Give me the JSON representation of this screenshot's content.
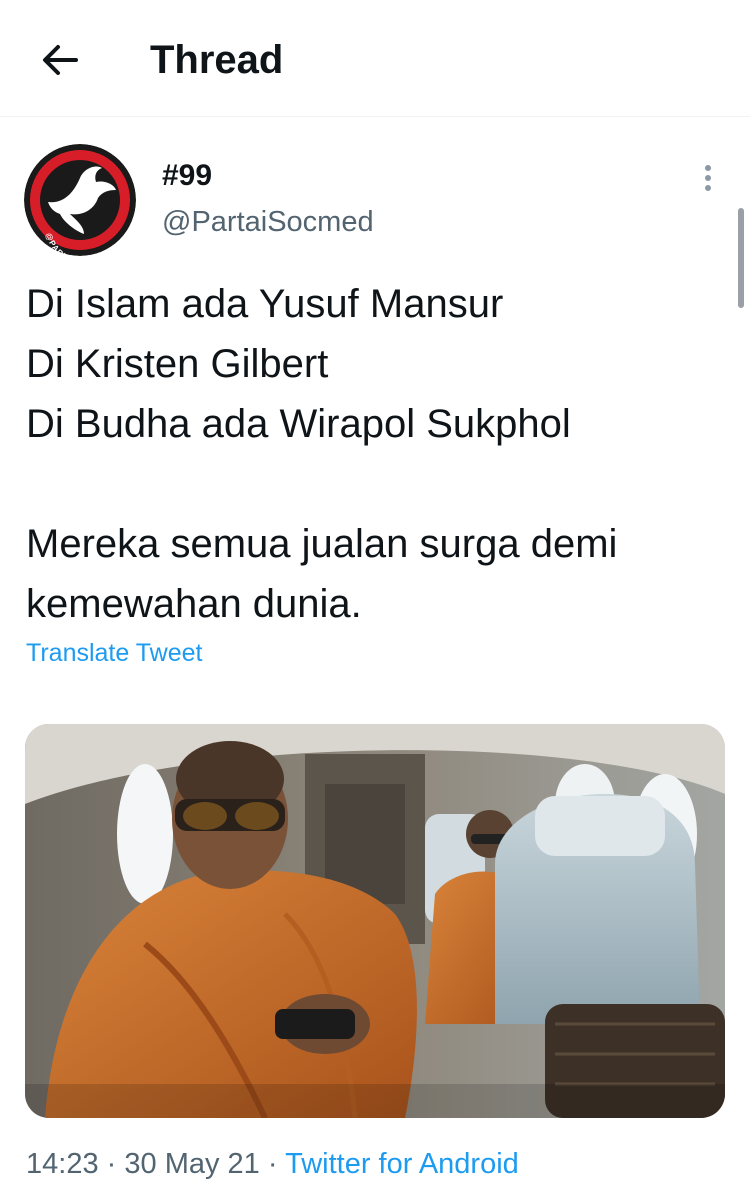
{
  "header": {
    "title": "Thread",
    "back_icon": "arrow-left-icon"
  },
  "tweet": {
    "author_name": "#99",
    "author_handle": "@PartaiSocmed",
    "avatar_ring_text": "@PARTAISOCMED",
    "lines": [
      "Di Islam ada Yusuf Mansur",
      "Di Kristen Gilbert",
      "Di Budha ada Wirapol Sukphol",
      "",
      "Mereka semua jualan surga demi",
      "kemewahan dunia."
    ],
    "translate_label": "Translate Tweet",
    "time": "14:23",
    "separator": "·",
    "date": "30 May 21",
    "source": "Twitter for Android"
  },
  "colors": {
    "link": "#1d9bf0",
    "secondary_text": "#536471",
    "robe": "#c9712a",
    "avatar_red": "#d71e28"
  }
}
